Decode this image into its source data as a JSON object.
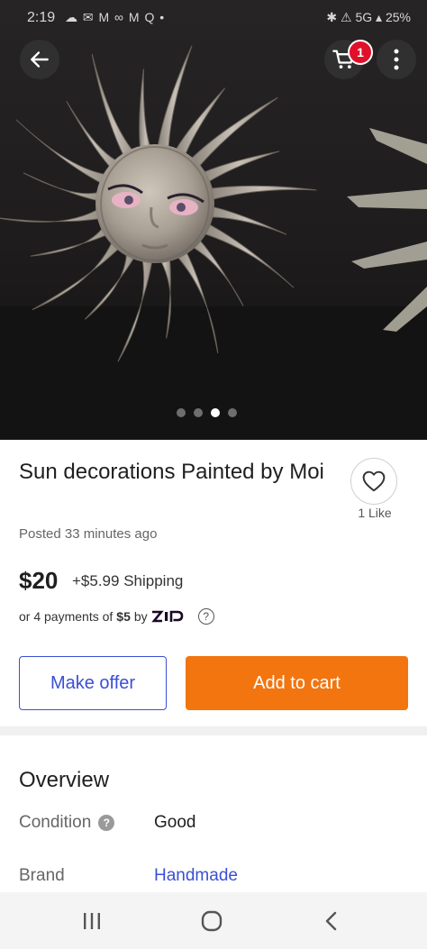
{
  "status_bar": {
    "time": "2:19",
    "notifications": "☁ ✉ M ∞ M Q •",
    "system": "✱ ⚠ 5G ▴ 25%"
  },
  "header": {
    "back_icon": "arrow-left-icon",
    "cart_icon": "shopping-cart-icon",
    "cart_badge": "1",
    "more_icon": "more-vertical-icon"
  },
  "gallery": {
    "image_count": 4,
    "active_index": 2
  },
  "listing": {
    "title": "Sun decorations Painted by Moi",
    "likes": "1 Like",
    "posted": "Posted 33 minutes ago",
    "price": "$20",
    "shipping": "+$5.99 Shipping",
    "payments_prefix": "or 4 payments of",
    "payments_amount": "$5",
    "payments_by": "by",
    "zip_logo": "Zip",
    "help_icon": "question-circle-icon"
  },
  "actions": {
    "make_offer": "Make offer",
    "add_to_cart": "Add to cart"
  },
  "overview": {
    "title": "Overview",
    "condition_label": "Condition",
    "condition_value": "Good",
    "brand_label": "Brand",
    "brand_value": "Handmade"
  },
  "colors": {
    "accent_blue": "#3b4fd4",
    "cta_orange": "#f2750f",
    "badge_red": "#e0102a"
  },
  "nav_bar": {
    "recents_icon": "recent-apps-icon",
    "home_icon": "home-icon",
    "back_icon": "back-chevron-icon"
  }
}
